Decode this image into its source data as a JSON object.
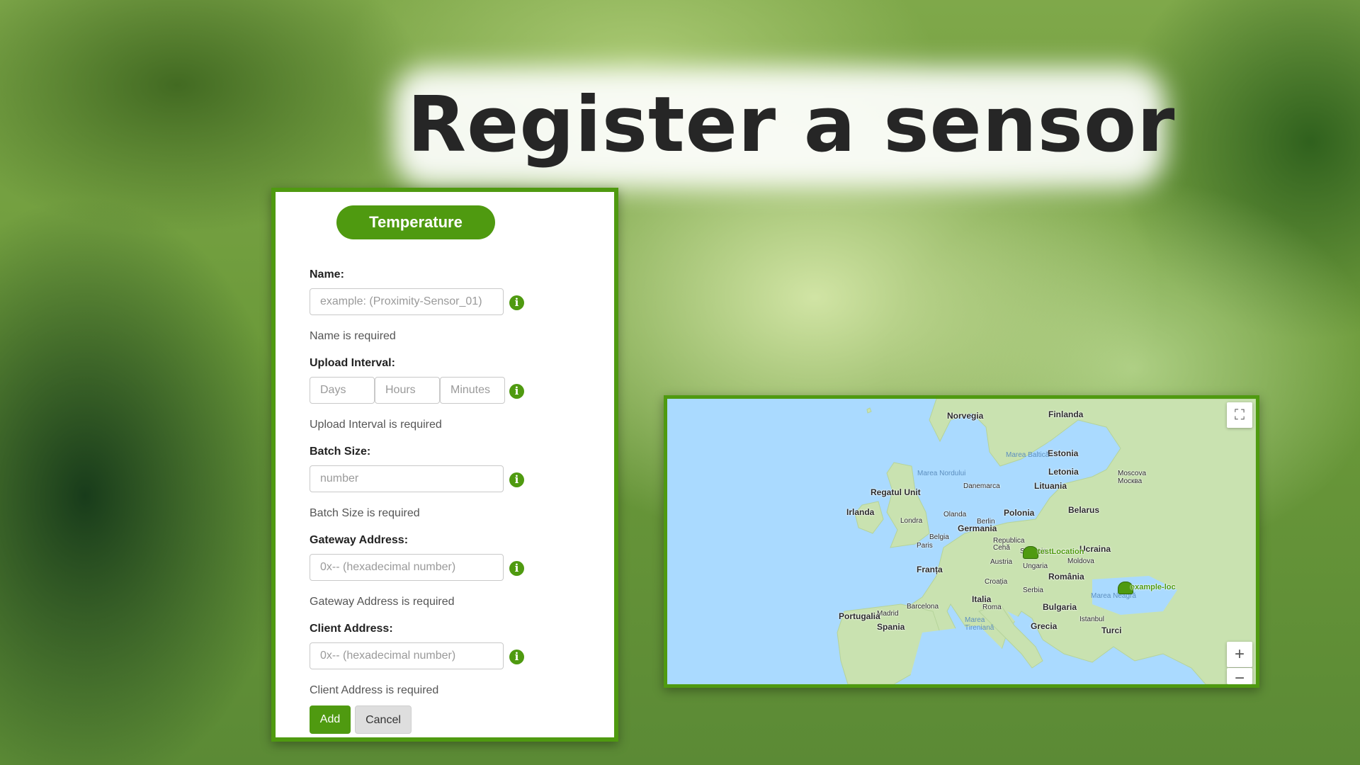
{
  "page": {
    "title": "Register a sensor"
  },
  "form": {
    "sensor_type": "Temperature",
    "name": {
      "label": "Name:",
      "placeholder": "example: (Proximity-Sensor_01)",
      "error": "Name is required"
    },
    "upload_interval": {
      "label": "Upload Interval:",
      "days_placeholder": "Days",
      "hours_placeholder": "Hours",
      "minutes_placeholder": "Minutes",
      "error": "Upload Interval is required"
    },
    "batch_size": {
      "label": "Batch Size:",
      "placeholder": "number",
      "error": "Batch Size is required"
    },
    "gateway_address": {
      "label": "Gateway Address:",
      "placeholder": "0x-- (hexadecimal number)",
      "error": "Gateway Address is required"
    },
    "client_address": {
      "label": "Client Address:",
      "placeholder": "0x-- (hexadecimal number)",
      "error": "Client Address is required"
    },
    "add_label": "Add",
    "cancel_label": "Cancel",
    "info_icon": "i"
  },
  "map": {
    "labels": {
      "norvegia": "Norvegia",
      "finlanda": "Finlanda",
      "estonia": "Estonia",
      "marea_baltica": "Marea Baltică",
      "marea_nordului": "Marea Nordului",
      "danemarca": "Danemarca",
      "letonia": "Letonia",
      "lituania": "Lituania",
      "moscova": "Moscova Москва",
      "regatul_unit": "Regatul Unit",
      "irlanda": "Irlanda",
      "belarus": "Belarus",
      "polonia": "Polonia",
      "olanda": "Olanda",
      "berlin": "Berlin",
      "germania": "Germania",
      "londra": "Londra",
      "belgia": "Belgia",
      "paris": "Paris",
      "republica_ceha": "Republica Cehă",
      "slovacia": "Slovacia",
      "ucraina": "Ucraina",
      "austria": "Austria",
      "ungaria": "Ungaria",
      "moldova": "Moldova",
      "franta": "Franța",
      "romania": "România",
      "croatia": "Croația",
      "serbia": "Serbia",
      "marea_neagra": "Marea Neagră",
      "italia": "Italia",
      "bulgaria": "Bulgaria",
      "barcelona": "Barcelona",
      "madrid": "Madrid",
      "roma": "Roma",
      "portugalia": "Portugalia",
      "spania": "Spania",
      "marea_tireniana": "Marea Tireniană",
      "istanbul": "Istanbul",
      "grecia": "Grecia",
      "turcia": "Turci"
    },
    "markers": [
      {
        "label": "testLocation"
      },
      {
        "label": "example-loc"
      }
    ],
    "fullscreen_icon": "⛶",
    "zoom_in": "+",
    "zoom_out": "−"
  },
  "colors": {
    "accent": "#4f9a10",
    "water": "#aadaff",
    "land": "#c9e2b0"
  }
}
